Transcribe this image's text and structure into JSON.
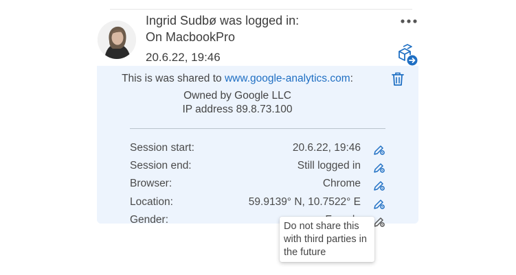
{
  "header": {
    "user_line": "Ingrid Sudbø was logged in:",
    "device_line": "On MacbookPro",
    "timestamp": "20.6.22, 19:46",
    "more_icon": "more-horizontal-icon",
    "share_icon": "share-out-icon"
  },
  "sharing": {
    "prefix": "This is was shared to ",
    "link": "www.google-analytics.com",
    "suffix": ":",
    "owner": "Owned by Google LLC",
    "ip": "IP address 89.8.73.100",
    "delete_icon": "trash-icon"
  },
  "details": [
    {
      "label": "Session start:",
      "value": "20.6.22, 19:46"
    },
    {
      "label": "Session end:",
      "value": "Still logged in"
    },
    {
      "label": "Browser:",
      "value": "Chrome"
    },
    {
      "label": "Location:",
      "value": "59.9139° N, 10.7522° E"
    },
    {
      "label": "Gender:",
      "value": "Female"
    }
  ],
  "tooltip": {
    "text": "Do not share this with third parties in the future"
  },
  "colors": {
    "panel_bg": "#edf4fd",
    "accent": "#1f6fc3",
    "text": "#444444"
  }
}
